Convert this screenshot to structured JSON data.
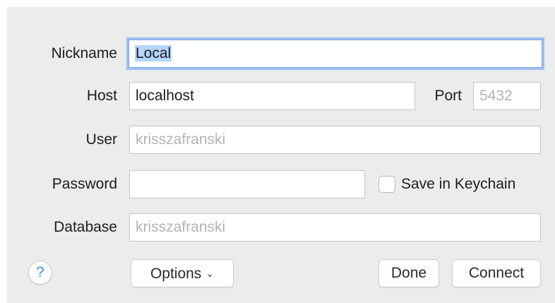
{
  "form": {
    "nickname_label": "Nickname",
    "nickname_value": "Local",
    "host_label": "Host",
    "host_value": "localhost",
    "port_label": "Port",
    "port_placeholder": "5432",
    "user_label": "User",
    "user_placeholder": "krisszafranski",
    "password_label": "Password",
    "password_value": "",
    "save_keychain_label": "Save in Keychain",
    "save_keychain_checked": false,
    "database_label": "Database",
    "database_placeholder": "krisszafranski"
  },
  "buttons": {
    "help_label": "?",
    "options_label": "Options",
    "done_label": "Done",
    "connect_label": "Connect"
  },
  "icons": {
    "help": "help-icon",
    "options_chevron": "chevron-down-icon"
  },
  "colors": {
    "focus_ring": "#9ec0ef",
    "selection": "#b4d5fe",
    "help_accent": "#3f8cf0",
    "panel_bg": "#ececec"
  }
}
